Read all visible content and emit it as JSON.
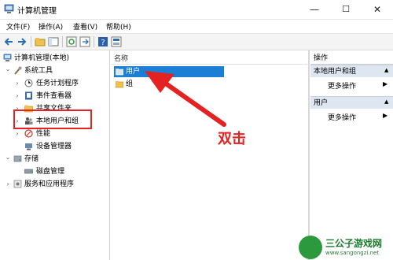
{
  "window": {
    "title": "计算机管理",
    "controls": [
      "—",
      "☐",
      "✕"
    ]
  },
  "menu": [
    "文件(F)",
    "操作(A)",
    "查看(V)",
    "帮助(H)"
  ],
  "toolbar": {
    "icons": [
      "back-icon",
      "forward-icon",
      "folder-up-icon",
      "show-tree-icon",
      "refresh-icon",
      "export-icon",
      "help-icon",
      "properties-icon"
    ]
  },
  "tree": [
    {
      "label": "计算机管理(本地)",
      "icon": "computer-management-icon"
    },
    {
      "label": "系统工具",
      "icon": "tools-icon",
      "arrow": "⌄"
    },
    {
      "label": "任务计划程序",
      "icon": "clock-icon",
      "arrow": "›"
    },
    {
      "label": "事件查看器",
      "icon": "event-viewer-icon",
      "arrow": "›"
    },
    {
      "label": "共享文件夹",
      "icon": "shared-folder-icon",
      "arrow": "›"
    },
    {
      "label": "本地用户和组",
      "icon": "users-icon",
      "arrow": "›"
    },
    {
      "label": "性能",
      "icon": "performance-icon",
      "arrow": "›"
    },
    {
      "label": "设备管理器",
      "icon": "device-manager-icon"
    },
    {
      "label": "存储",
      "icon": "storage-icon",
      "arrow": "⌄"
    },
    {
      "label": "磁盘管理",
      "icon": "disk-icon"
    },
    {
      "label": "服务和应用程序",
      "icon": "services-icon",
      "arrow": "›"
    }
  ],
  "list": {
    "column": "名称",
    "rows": [
      {
        "label": "用户",
        "selected": true
      },
      {
        "label": "组",
        "selected": false
      }
    ]
  },
  "actions": {
    "header": "操作",
    "sections": [
      {
        "title": "本地用户和组",
        "item": "更多操作"
      },
      {
        "title": "用户",
        "item": "更多操作"
      }
    ]
  },
  "annotation": {
    "text": "双击",
    "color": "#e52222"
  },
  "watermark": {
    "name": "三公子游戏网",
    "url": "www.sangongzi.net"
  },
  "colors": {
    "selection": "#1c7fd6",
    "annotation": "#e52222",
    "action_section_bg": "#dde6f1"
  }
}
